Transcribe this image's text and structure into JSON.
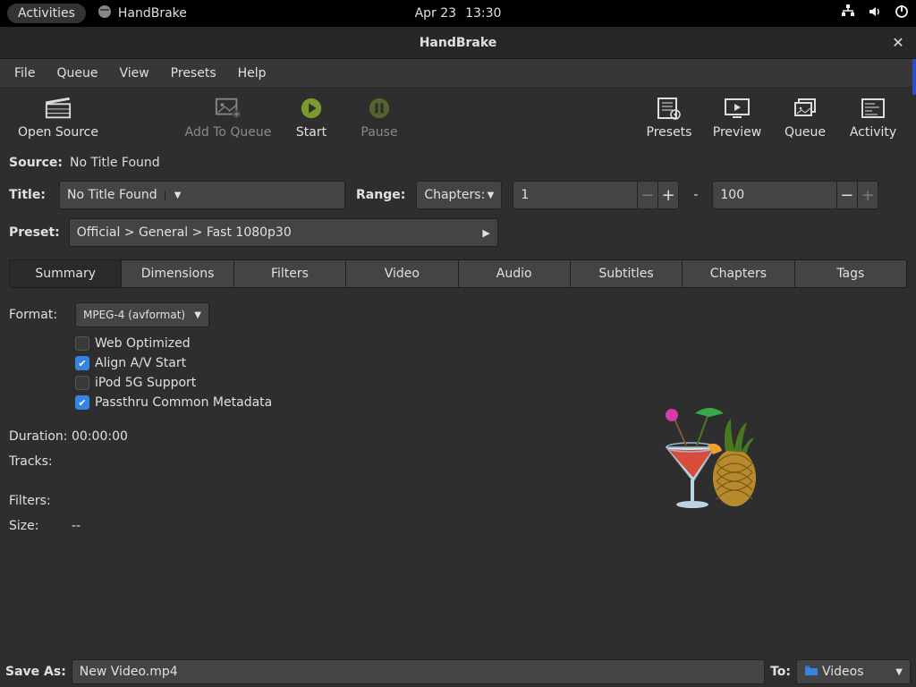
{
  "gnome": {
    "activities": "Activities",
    "app_name": "HandBrake",
    "date": "Apr 23",
    "time": "13:30"
  },
  "window": {
    "title": "HandBrake"
  },
  "menubar": {
    "items": [
      "File",
      "Queue",
      "View",
      "Presets",
      "Help"
    ]
  },
  "toolbar": {
    "open": "Open Source",
    "add": "Add To Queue",
    "start": "Start",
    "pause": "Pause",
    "presets": "Presets",
    "preview": "Preview",
    "queue": "Queue",
    "activity": "Activity"
  },
  "source": {
    "label": "Source:",
    "value": "No Title Found"
  },
  "title": {
    "label": "Title:",
    "value": "No Title Found",
    "range_label": "Range:",
    "range_mode": "Chapters:",
    "from": "1",
    "to": "100"
  },
  "preset": {
    "label": "Preset:",
    "value": "Official > General > Fast 1080p30"
  },
  "tabs": [
    "Summary",
    "Dimensions",
    "Filters",
    "Video",
    "Audio",
    "Subtitles",
    "Chapters",
    "Tags"
  ],
  "summary": {
    "format_label": "Format:",
    "format_value": "MPEG-4 (avformat)",
    "web_opt": "Web Optimized",
    "align_av": "Align A/V Start",
    "ipod": "iPod 5G Support",
    "passthru": "Passthru Common Metadata",
    "duration_label": "Duration:",
    "duration_value": "00:00:00",
    "tracks_label": "Tracks:",
    "tracks_value": "",
    "filters_label": "Filters:",
    "filters_value": "",
    "size_label": "Size:",
    "size_value": "--",
    "checks": {
      "web_opt": false,
      "align_av": true,
      "ipod": false,
      "passthru": true
    }
  },
  "save": {
    "label": "Save As:",
    "filename": "New Video.mp4",
    "to_label": "To:",
    "to_value": "Videos"
  }
}
